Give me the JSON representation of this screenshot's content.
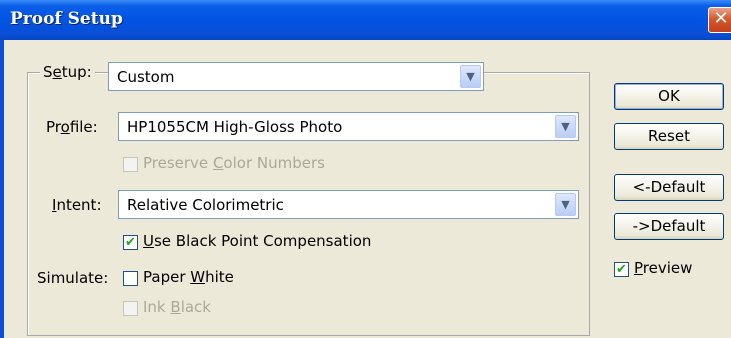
{
  "window": {
    "title": "Proof Setup",
    "close_glyph": "✕"
  },
  "setup": {
    "label_pre": "S",
    "label_mnemonic": "e",
    "label_post": "tup:",
    "value": "Custom"
  },
  "profile": {
    "label_pre": "Pr",
    "label_mnemonic": "o",
    "label_post": "file:",
    "value": "HP1055CM High-Gloss Photo"
  },
  "preserve": {
    "label_pre": "Preserve ",
    "label_mnemonic": "C",
    "label_post": "olor Numbers",
    "checked": false,
    "enabled": false
  },
  "intent": {
    "label_pre": "",
    "label_mnemonic": "I",
    "label_post": "ntent:",
    "value": "Relative Colorimetric"
  },
  "bpc": {
    "label_pre": "",
    "label_mnemonic": "U",
    "label_post": "se Black Point Compensation",
    "checked": true,
    "check_glyph": "✔"
  },
  "simulate": {
    "label": "Simulate:",
    "paper_white": {
      "label_pre": "Paper ",
      "label_mnemonic": "W",
      "label_post": "hite",
      "checked": false
    },
    "ink_black": {
      "label_pre": "Ink ",
      "label_mnemonic": "B",
      "label_post": "lack",
      "checked": false,
      "enabled": false
    }
  },
  "buttons": {
    "ok": "OK",
    "reset": "Reset",
    "prev_default": "<-Default",
    "next_default": "->Default"
  },
  "preview": {
    "label_pre": "",
    "label_mnemonic": "P",
    "label_post": "review",
    "checked": true,
    "check_glyph": "✔"
  },
  "icons": {
    "dropdown_glyph": "▼"
  },
  "colors": {
    "titlebar": "#0054e3",
    "dialog_bg": "#ece9d8",
    "close_button": "#d6582f",
    "check_mark": "#21a121"
  }
}
